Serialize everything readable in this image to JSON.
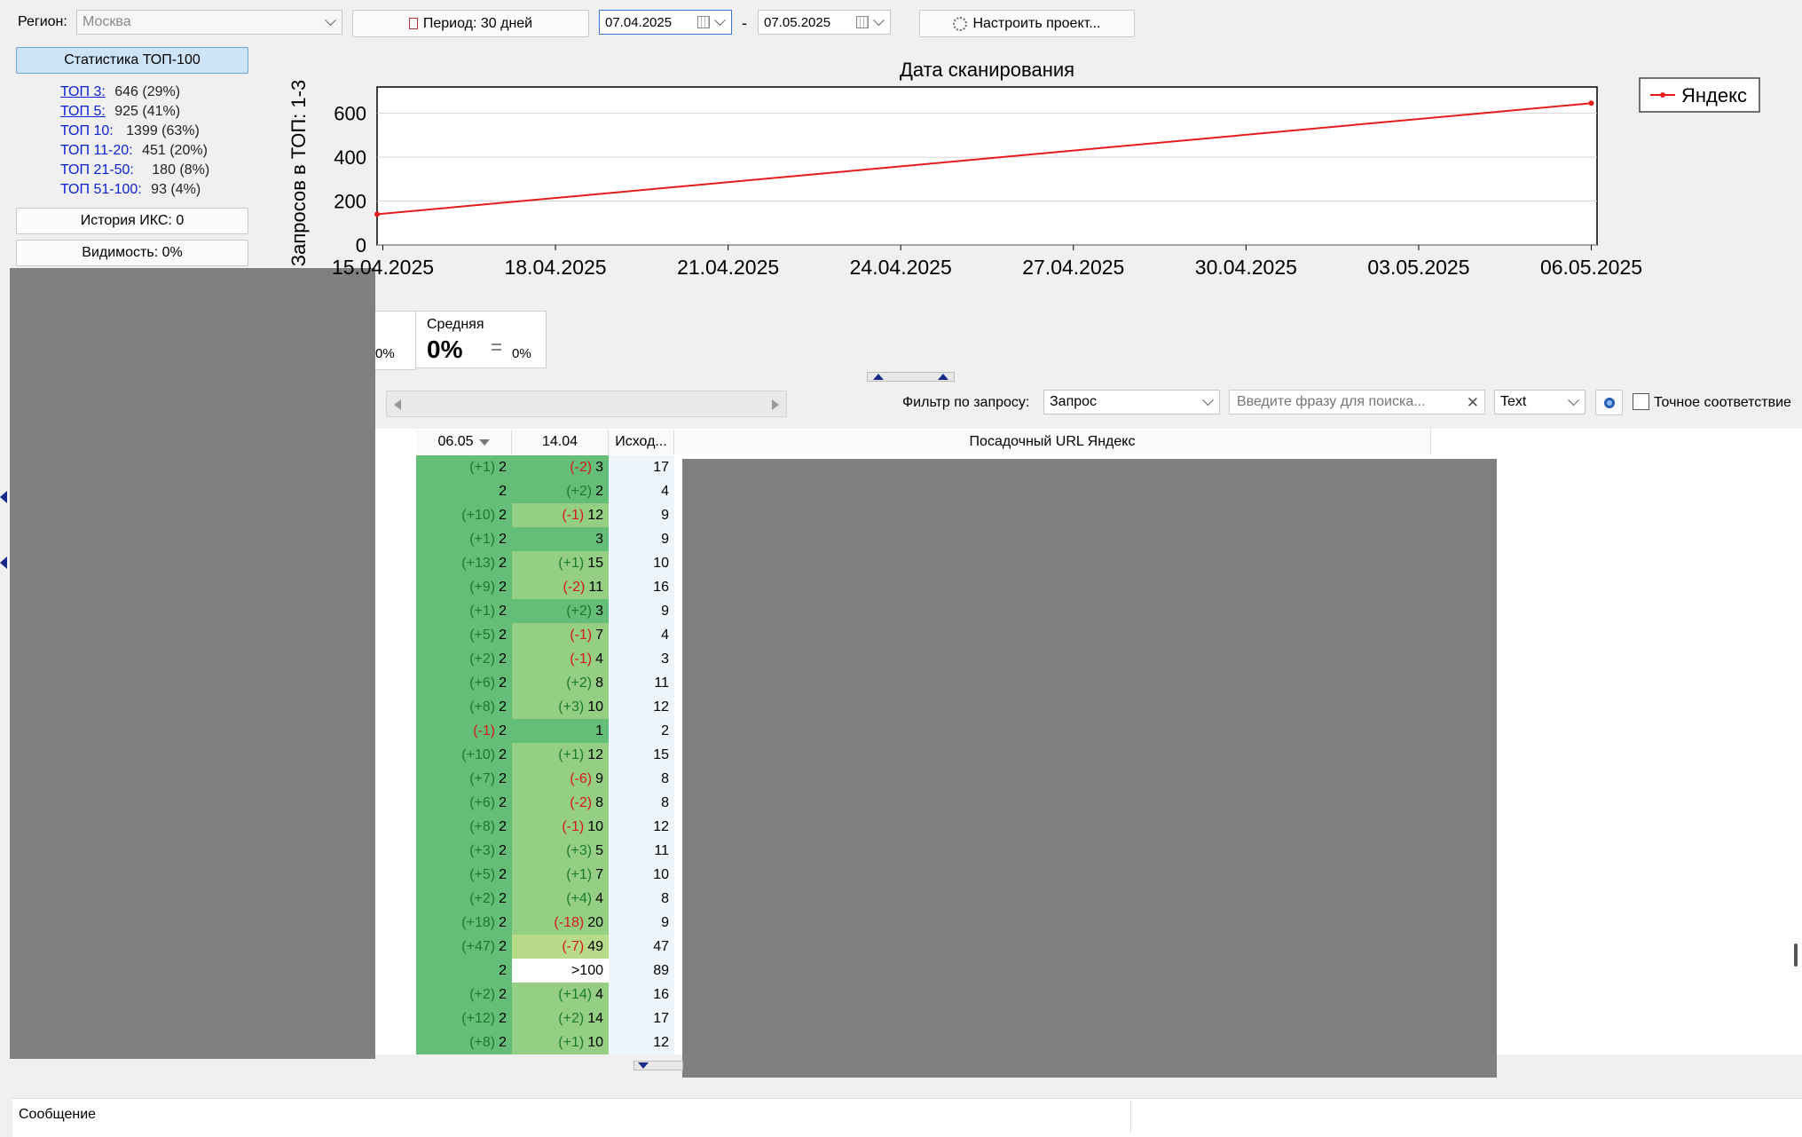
{
  "toolbar": {
    "region_label": "Регион:",
    "region_value": "Москва",
    "period_label": "Период: 30 дней",
    "date_from": "07.04.2025",
    "date_sep": "-",
    "date_to": "07.05.2025",
    "configure_label": "Настроить проект..."
  },
  "sidebar": {
    "stats_button": "Статистика ТОП-100",
    "stats": [
      {
        "label": "ТОП 3:",
        "value": "646 (29%)"
      },
      {
        "label": "ТОП 5:",
        "value": "925 (41%)"
      },
      {
        "label": "ТОП 10:",
        "value": "1399 (63%)"
      },
      {
        "label": "ТОП 11-20:",
        "value": "451 (20%)"
      },
      {
        "label": "ТОП 21-50:",
        "value": "180 (8%)"
      },
      {
        "label": "ТОП 51-100:",
        "value": "93 (4%)"
      }
    ],
    "iks_button": "История ИКС: 0",
    "visibility_button": "Видимость: 0%"
  },
  "chart_data": {
    "type": "line",
    "title": "Дата сканирования",
    "ylabel": "Запросов в ТОП: 1-3",
    "xlabel": "",
    "ylim": [
      0,
      720
    ],
    "yticks": [
      0,
      200,
      400,
      600
    ],
    "xtick_labels": [
      "15.04.2025",
      "18.04.2025",
      "21.04.2025",
      "24.04.2025",
      "27.04.2025",
      "30.04.2025",
      "03.05.2025",
      "06.05.2025"
    ],
    "xtick_days": [
      0,
      3,
      6,
      9,
      12,
      15,
      18,
      21
    ],
    "x_range": [
      -0.1,
      21.1
    ],
    "grid": true,
    "legend": "top-right",
    "series": [
      {
        "name": "Яндекс",
        "color": "#e51c1c",
        "x": [
          "14.04.2025",
          "06.05.2025"
        ],
        "x_days": [
          -0.1,
          21
        ],
        "values": [
          140,
          646
        ]
      }
    ]
  },
  "summary": {
    "left_partial_pct": "0%",
    "avg_label": "Средняя",
    "avg_value": "0%",
    "avg_change": "0%"
  },
  "filter": {
    "label": "Фильтр по запросу:",
    "field_value": "Запрос",
    "search_placeholder": "Введите фразу для поиска...",
    "mode_value": "Text",
    "exact_label": "Точное соответствие"
  },
  "table": {
    "columns": [
      "06.05",
      "14.04",
      "Исход...",
      "Посадочный URL Яндекс"
    ],
    "rows": [
      {
        "c1_delta": "(+1)",
        "c1": "2",
        "c2_delta": "(-2)",
        "c2": "3",
        "c3": "17"
      },
      {
        "c1_delta": "",
        "c1": "2",
        "c2_delta": "(+2)",
        "c2": "2",
        "c3": "4"
      },
      {
        "c1_delta": "(+10)",
        "c1": "2",
        "c2_delta": "(-1)",
        "c2": "12",
        "c3": "9"
      },
      {
        "c1_delta": "(+1)",
        "c1": "2",
        "c2_delta": "",
        "c2": "3",
        "c3": "9"
      },
      {
        "c1_delta": "(+13)",
        "c1": "2",
        "c2_delta": "(+1)",
        "c2": "15",
        "c3": "10"
      },
      {
        "c1_delta": "(+9)",
        "c1": "2",
        "c2_delta": "(-2)",
        "c2": "11",
        "c3": "16"
      },
      {
        "c1_delta": "(+1)",
        "c1": "2",
        "c2_delta": "(+2)",
        "c2": "3",
        "c3": "9"
      },
      {
        "c1_delta": "(+5)",
        "c1": "2",
        "c2_delta": "(-1)",
        "c2": "7",
        "c3": "4"
      },
      {
        "c1_delta": "(+2)",
        "c1": "2",
        "c2_delta": "(-1)",
        "c2": "4",
        "c3": "3"
      },
      {
        "c1_delta": "(+6)",
        "c1": "2",
        "c2_delta": "(+2)",
        "c2": "8",
        "c3": "11"
      },
      {
        "c1_delta": "(+8)",
        "c1": "2",
        "c2_delta": "(+3)",
        "c2": "10",
        "c3": "12"
      },
      {
        "c1_delta": "(-1)",
        "c1": "2",
        "c2_delta": "",
        "c2": "1",
        "c3": "2"
      },
      {
        "c1_delta": "(+10)",
        "c1": "2",
        "c2_delta": "(+1)",
        "c2": "12",
        "c3": "15"
      },
      {
        "c1_delta": "(+7)",
        "c1": "2",
        "c2_delta": "(-6)",
        "c2": "9",
        "c3": "8"
      },
      {
        "c1_delta": "(+6)",
        "c1": "2",
        "c2_delta": "(-2)",
        "c2": "8",
        "c3": "8"
      },
      {
        "c1_delta": "(+8)",
        "c1": "2",
        "c2_delta": "(-1)",
        "c2": "10",
        "c3": "12"
      },
      {
        "c1_delta": "(+3)",
        "c1": "2",
        "c2_delta": "(+3)",
        "c2": "5",
        "c3": "11"
      },
      {
        "c1_delta": "(+5)",
        "c1": "2",
        "c2_delta": "(+1)",
        "c2": "7",
        "c3": "10"
      },
      {
        "c1_delta": "(+2)",
        "c1": "2",
        "c2_delta": "(+4)",
        "c2": "4",
        "c3": "8"
      },
      {
        "c1_delta": "(+18)",
        "c1": "2",
        "c2_delta": "(-18)",
        "c2": "20",
        "c3": "9"
      },
      {
        "c1_delta": "(+47)",
        "c1": "2",
        "c2_delta": "(-7)",
        "c2": "49",
        "c3": "47"
      },
      {
        "c1_delta": "",
        "c1": "2",
        "c2_delta": "",
        "c2": ">100",
        "c3": "89"
      },
      {
        "c1_delta": "(+2)",
        "c1": "2",
        "c2_delta": "(+14)",
        "c2": "4",
        "c3": "16"
      },
      {
        "c1_delta": "(+12)",
        "c1": "2",
        "c2_delta": "(+2)",
        "c2": "14",
        "c3": "17"
      },
      {
        "c1_delta": "(+8)",
        "c1": "2",
        "c2_delta": "(+1)",
        "c2": "10",
        "c3": "12"
      }
    ]
  },
  "messages": {
    "header": "Сообщение"
  },
  "colors": {
    "cell_green": "#65be78",
    "cell_light_green": "#95cf83",
    "cell_pale_green": "#b8db8a",
    "cell_blue": "#eef6fc",
    "redacted": "#808080",
    "line_red": "#e51c1c"
  }
}
